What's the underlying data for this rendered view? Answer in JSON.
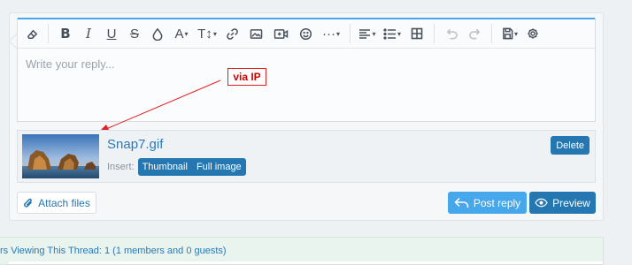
{
  "editor": {
    "placeholder": "Write your reply...",
    "toolbar": [
      {
        "name": "eraser-icon"
      },
      {
        "name": "bold-icon",
        "glyph": "B"
      },
      {
        "name": "italic-icon",
        "glyph": "I"
      },
      {
        "name": "underline-icon",
        "glyph": "U"
      },
      {
        "name": "strikethrough-icon",
        "glyph": "S"
      },
      {
        "name": "color-icon"
      },
      {
        "name": "font-icon",
        "glyph": "A"
      },
      {
        "name": "font-size-icon",
        "glyph": "T↕"
      },
      {
        "name": "link-icon"
      },
      {
        "name": "image-icon"
      },
      {
        "name": "media-icon"
      },
      {
        "name": "smilie-icon"
      },
      {
        "name": "more-icon"
      },
      {
        "name": "align-icon"
      },
      {
        "name": "list-icon"
      },
      {
        "name": "table-icon"
      },
      {
        "name": "undo-icon"
      },
      {
        "name": "redo-icon"
      },
      {
        "name": "drafts-icon"
      },
      {
        "name": "settings-icon"
      }
    ],
    "accent": "#47a7eb"
  },
  "annotation": {
    "label": "via IP",
    "color": "#e02020"
  },
  "attachment": {
    "file_name": "Snap7.gif",
    "insert_label": "Insert:",
    "insert_options": [
      "Thumbnail",
      "Full image"
    ],
    "delete_label": "Delete"
  },
  "actions": {
    "attach_label": "Attach files",
    "post_label": "Post reply",
    "preview_label": "Preview",
    "primary_color": "#2577b1",
    "cta_color": "#47a7eb"
  },
  "viewers": {
    "text": "rs Viewing This Thread: 1 (1 members and 0 guests)"
  }
}
